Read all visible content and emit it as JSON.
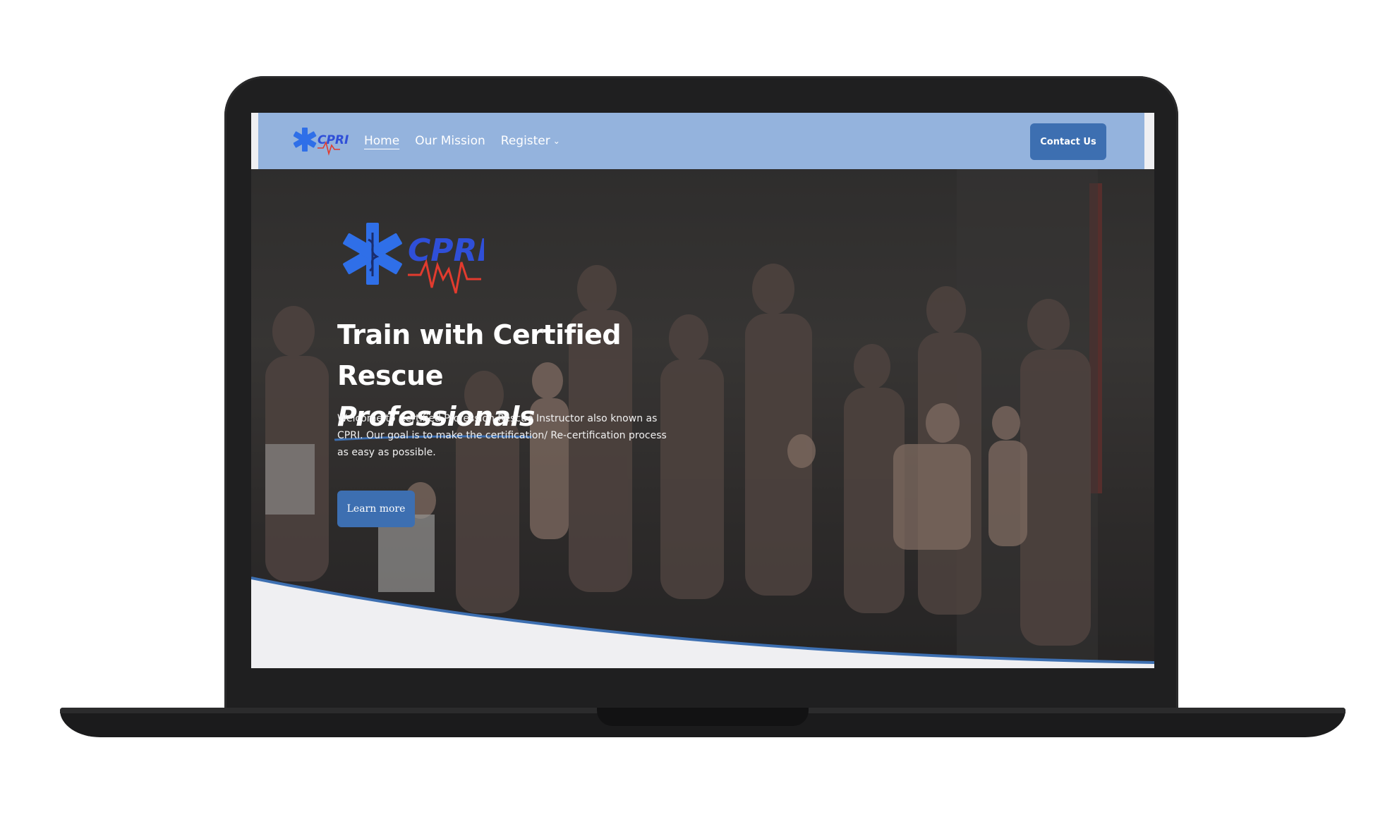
{
  "nav": {
    "logo_alt": "CPRI",
    "links": [
      {
        "label": "Home",
        "active": true
      },
      {
        "label": "Our Mission",
        "active": false
      },
      {
        "label": "Register",
        "has_dropdown": true
      }
    ],
    "contact_label": "Contact Us",
    "bg_color": "#94b3dd",
    "button_color": "#3d6fb1"
  },
  "hero": {
    "logo_text": "CPRI",
    "title_line1": "Train with Certified Rescue",
    "title_emphasis": "Professionals",
    "description": "Welcome to Certified Profession Rescue Instructor also known as CPRI. Our goal is to make the certification/ Re-certification process as easy as possible.",
    "button_label": "Learn more",
    "accent_color": "#3d6fb1",
    "background": "group-photo-cpr-training"
  },
  "icons": {
    "logo": "star-of-life-icon",
    "heartbeat": "heartbeat-line-icon",
    "dropdown": "chevron-down-icon"
  }
}
